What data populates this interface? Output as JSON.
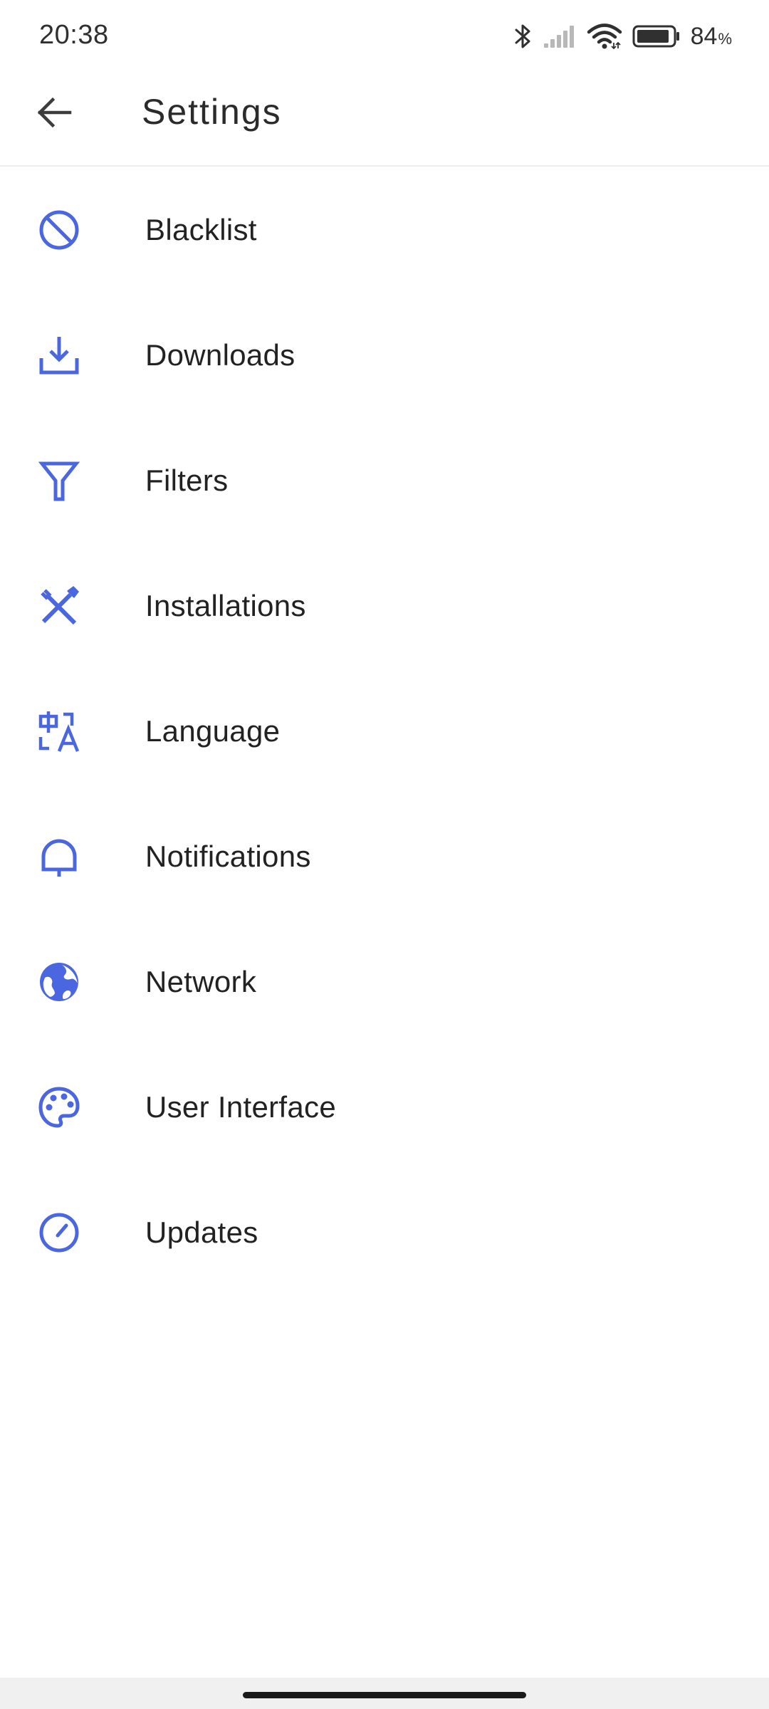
{
  "status_bar": {
    "time": "20:38",
    "battery_level": "84",
    "battery_unit": "%",
    "icons": [
      "bluetooth-icon",
      "cellular-signal-icon",
      "wifi-icon",
      "battery-icon"
    ]
  },
  "app_bar": {
    "title": "Settings",
    "back_icon": "arrow-back-icon"
  },
  "accent_color": "#4a66e0",
  "settings": {
    "items": [
      {
        "label": "Blacklist",
        "icon": "block-icon"
      },
      {
        "label": "Downloads",
        "icon": "download-icon"
      },
      {
        "label": "Filters",
        "icon": "filter-icon"
      },
      {
        "label": "Installations",
        "icon": "tools-icon"
      },
      {
        "label": "Language",
        "icon": "translate-icon"
      },
      {
        "label": "Notifications",
        "icon": "bell-icon"
      },
      {
        "label": "Network",
        "icon": "globe-icon"
      },
      {
        "label": "User Interface",
        "icon": "palette-icon"
      },
      {
        "label": "Updates",
        "icon": "gauge-icon"
      }
    ]
  }
}
